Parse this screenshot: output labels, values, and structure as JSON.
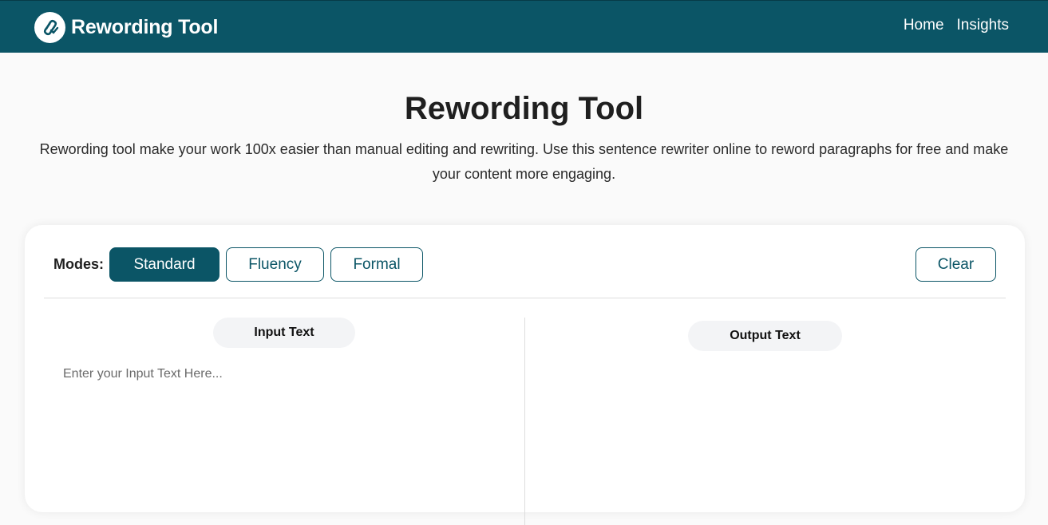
{
  "header": {
    "brand_name": "Rewording Tool",
    "brand_color": "#0b5566",
    "logo_icon": "paperclip-check-icon",
    "nav": [
      {
        "label": "Home"
      },
      {
        "label": "Insights"
      }
    ]
  },
  "hero": {
    "title": "Rewording Tool",
    "description": "Rewording tool make your work 100x easier than manual editing and rewriting. Use this sentence rewriter online to reword paragraphs for free and make your content more engaging."
  },
  "toolbar": {
    "modes_label": "Modes:",
    "modes": [
      {
        "label": "Standard",
        "active": true
      },
      {
        "label": "Fluency",
        "active": false
      },
      {
        "label": "Formal",
        "active": false
      }
    ],
    "clear_label": "Clear"
  },
  "editor": {
    "input_title": "Input Text",
    "input_value": "",
    "input_placeholder": "Enter your Input Text Here...",
    "output_title": "Output Text",
    "output_value": ""
  }
}
